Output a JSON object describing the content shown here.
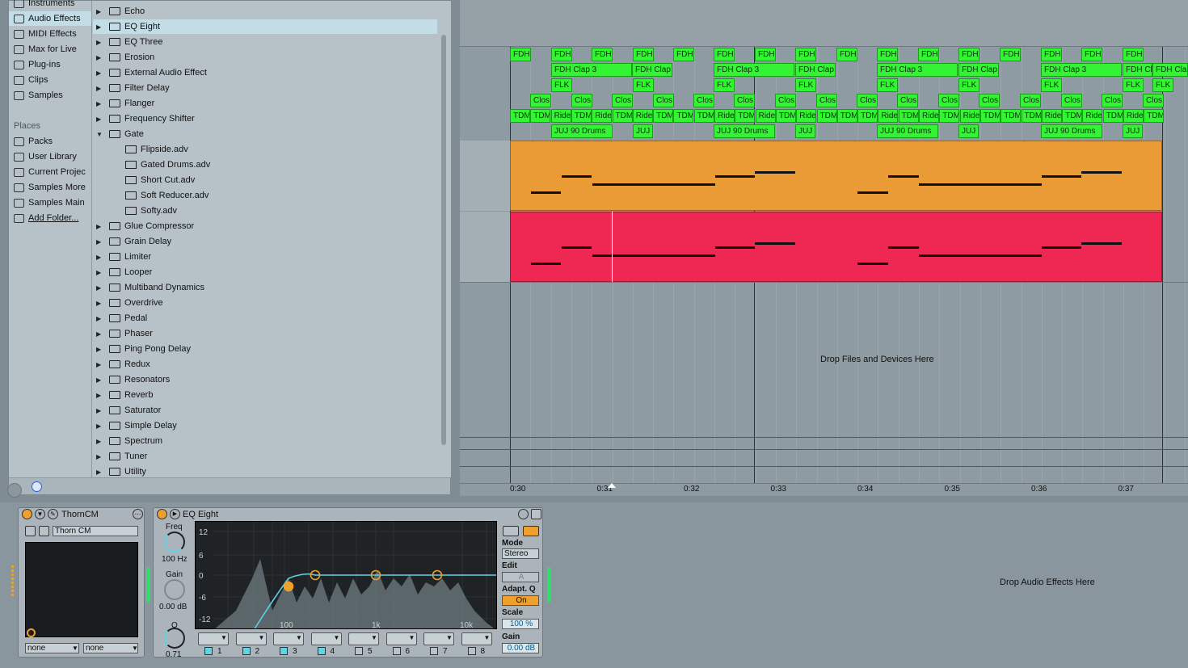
{
  "categories": {
    "items": [
      {
        "label": "Instruments",
        "icon": "instruments-icon",
        "selected": false
      },
      {
        "label": "Audio Effects",
        "icon": "audio-effects-icon",
        "selected": true
      },
      {
        "label": "MIDI Effects",
        "icon": "midi-effects-icon",
        "selected": false
      },
      {
        "label": "Max for Live",
        "icon": "max-for-live-icon",
        "selected": false
      },
      {
        "label": "Plug-ins",
        "icon": "plugins-icon",
        "selected": false
      },
      {
        "label": "Clips",
        "icon": "clips-icon",
        "selected": false
      },
      {
        "label": "Samples",
        "icon": "samples-icon",
        "selected": false
      }
    ],
    "places_header": "Places",
    "places": [
      {
        "label": "Packs",
        "icon": "packs-icon"
      },
      {
        "label": "User Library",
        "icon": "user-library-icon"
      },
      {
        "label": "Current Projec",
        "icon": "folder-icon"
      },
      {
        "label": "Samples More",
        "icon": "folder-icon"
      },
      {
        "label": "Samples Main",
        "icon": "folder-icon"
      },
      {
        "label": "Add Folder...",
        "icon": "add-folder-icon"
      }
    ]
  },
  "list": {
    "items": [
      {
        "label": "Echo",
        "type": "folder"
      },
      {
        "label": "EQ Eight",
        "type": "folder",
        "selected": true
      },
      {
        "label": "EQ Three",
        "type": "folder"
      },
      {
        "label": "Erosion",
        "type": "folder"
      },
      {
        "label": "External Audio Effect",
        "type": "folder"
      },
      {
        "label": "Filter Delay",
        "type": "folder"
      },
      {
        "label": "Flanger",
        "type": "folder"
      },
      {
        "label": "Frequency Shifter",
        "type": "folder"
      },
      {
        "label": "Gate",
        "type": "folder",
        "expanded": true
      },
      {
        "label": "Flipside.adv",
        "type": "preset"
      },
      {
        "label": "Gated Drums.adv",
        "type": "preset"
      },
      {
        "label": "Short Cut.adv",
        "type": "preset"
      },
      {
        "label": "Soft Reducer.adv",
        "type": "preset"
      },
      {
        "label": "Softy.adv",
        "type": "preset"
      },
      {
        "label": "Glue Compressor",
        "type": "folder"
      },
      {
        "label": "Grain Delay",
        "type": "folder"
      },
      {
        "label": "Limiter",
        "type": "folder"
      },
      {
        "label": "Looper",
        "type": "folder"
      },
      {
        "label": "Multiband Dynamics",
        "type": "folder"
      },
      {
        "label": "Overdrive",
        "type": "folder"
      },
      {
        "label": "Pedal",
        "type": "folder"
      },
      {
        "label": "Phaser",
        "type": "folder"
      },
      {
        "label": "Ping Pong Delay",
        "type": "folder"
      },
      {
        "label": "Redux",
        "type": "folder"
      },
      {
        "label": "Resonators",
        "type": "folder"
      },
      {
        "label": "Reverb",
        "type": "folder"
      },
      {
        "label": "Saturator",
        "type": "folder"
      },
      {
        "label": "Simple Delay",
        "type": "folder"
      },
      {
        "label": "Spectrum",
        "type": "folder"
      },
      {
        "label": "Tuner",
        "type": "folder"
      },
      {
        "label": "Utility",
        "type": "folder"
      }
    ]
  },
  "arrangement": {
    "drop_text": "Drop Files and Devices Here",
    "time_labels": [
      "0:30",
      "0:31",
      "0:32",
      "0:33",
      "0:34",
      "0:35",
      "0:36",
      "0:37"
    ],
    "clip_lanes": [
      {
        "pattern": [
          "FDH",
          "FDH",
          "FDH",
          "FDH",
          "FDH",
          "FDH",
          "FDH",
          "FDH",
          "FDH",
          "FDH",
          "FDH",
          "FDH",
          "FDH",
          "FDH",
          "FDH",
          "FDH"
        ]
      },
      {
        "pattern": [
          "FDH  Clap  3",
          "FDH  Clap",
          "FDH  Clap  3",
          "FDH  Clap",
          "FDH  Clap  3",
          "FDH  Clap",
          "FDH  Clap  3",
          "FDH  Cl",
          "FDH  Cla"
        ]
      },
      {
        "pattern": [
          "FLK",
          "FLK",
          "FLK",
          "FLK",
          "FLK",
          "FLK",
          "FLK",
          "FLK",
          "FLK"
        ]
      },
      {
        "pattern": [
          "Clos",
          "Clos",
          "Clos",
          "Clos",
          "Clos",
          "Clos",
          "Clos",
          "Clos",
          "Clos",
          "Clos",
          "Clos",
          "Clos",
          "Clos",
          "Clos",
          "Clos",
          "Clos"
        ]
      },
      {
        "pattern": [
          "TDM",
          "TDM",
          "Ride",
          "TDM",
          "Ride",
          "TDM",
          "Ride",
          "TDM",
          "TDM",
          "TDM",
          "Ride",
          "TDM",
          "Ride",
          "TDM",
          "Ride",
          "TDM",
          "TDM",
          "TDM",
          "Ride",
          "TDM",
          "Ride",
          "TDM",
          "Ride",
          "TDM",
          "TDM",
          "TDM",
          "Ride",
          "TDM",
          "Ride",
          "TDM",
          "Ride",
          "TDM"
        ]
      },
      {
        "pattern": [
          "JUJ  90  Drums",
          "JUJ",
          "JUJ  90  Drums",
          "JUJ",
          "JUJ  90  Drums",
          "JUJ",
          "JUJ  90  Drums",
          "JUJ"
        ]
      }
    ],
    "colors": {
      "clip": "#33f433",
      "orange": "#ea9b35",
      "red": "#ef2853"
    }
  },
  "devices": {
    "thorn": {
      "title": "ThornCM",
      "preset": "Thorn CM",
      "dd1": "none",
      "dd2": "none"
    },
    "eq": {
      "title": "EQ Eight",
      "freq_label": "Freq",
      "freq_value": "100 Hz",
      "gain_label": "Gain",
      "gain_value": "0.00 dB",
      "q_label": "Q",
      "q_value": "0.71",
      "db_ticks": [
        "12",
        "6",
        "0",
        "-6",
        "-12"
      ],
      "freq_ticks": [
        "100",
        "1k",
        "10k"
      ],
      "mode_label": "Mode",
      "mode_value": "Stereo",
      "edit_label": "Edit",
      "edit_value": "A",
      "adapt_label": "Adapt. Q",
      "adapt_value": "On",
      "scale_label": "Scale",
      "scale_value": "100 %",
      "out_gain_label": "Gain",
      "out_gain_value": "0.00 dB",
      "bands": [
        "1",
        "2",
        "3",
        "4",
        "5",
        "6",
        "7",
        "8"
      ],
      "band_enabled": [
        true,
        true,
        true,
        true,
        false,
        false,
        false,
        false
      ]
    },
    "drop_text": "Drop Audio Effects Here"
  }
}
